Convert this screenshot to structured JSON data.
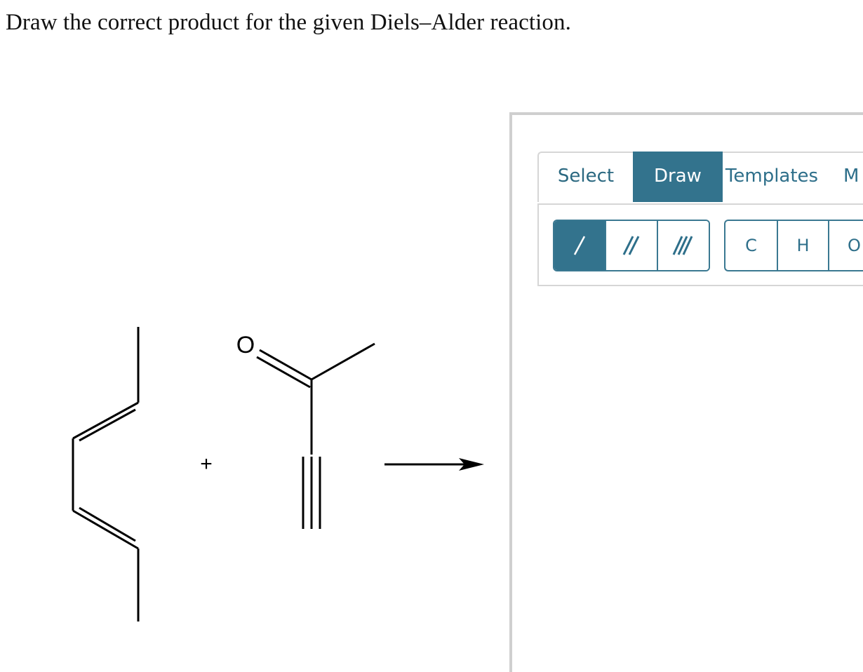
{
  "question": {
    "text": "Draw the correct product for the given Diels–Alder reaction."
  },
  "reaction": {
    "plus_sign": "+",
    "oxygen_label": "O"
  },
  "widget": {
    "tabs": [
      "Select",
      "Draw",
      "Templates",
      "M"
    ],
    "active_tab": "Draw",
    "bond_tools": [
      "single-bond",
      "double-bond",
      "triple-bond"
    ],
    "active_bond_tool": "single-bond",
    "atom_tools": [
      "C",
      "H",
      "O"
    ],
    "colors": {
      "accent": "#33738d",
      "tab_text": "#2e6f8a",
      "panel_border": "#cfcfcf"
    }
  }
}
